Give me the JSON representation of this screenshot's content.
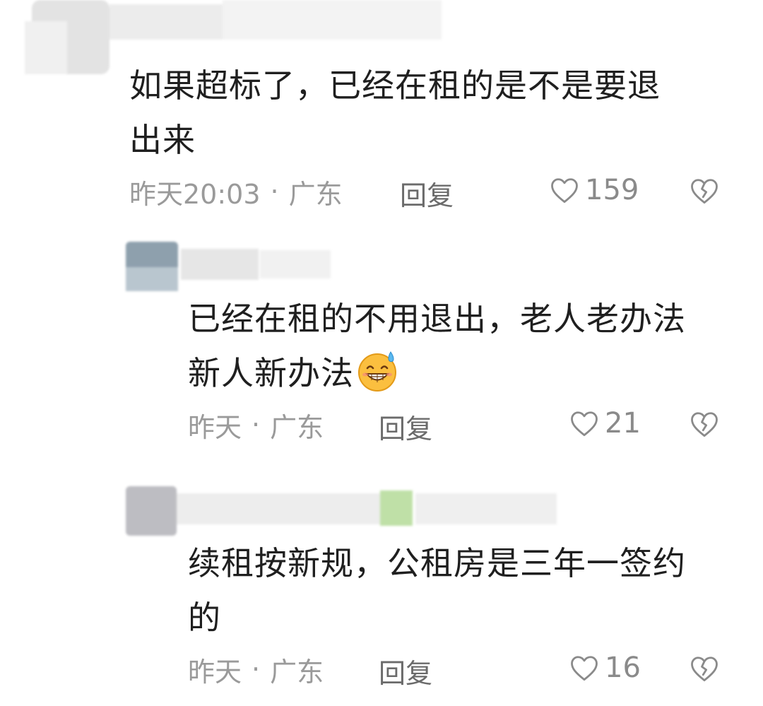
{
  "comments": [
    {
      "text_line1": "如果超标了，已经在租的是不是要退",
      "text_line2": "出来",
      "time": "昨天20:03",
      "separator": "·",
      "location": "广东",
      "reply_label": "回复",
      "likes": "159",
      "icons": {
        "like": "heart-outline-icon",
        "dislike": "broken-heart-icon"
      }
    },
    {
      "text_line1": "已经在租的不用退出，老人老办法",
      "text_line2": "新人新办法",
      "emoji": "grinning-sweat-emoji",
      "time": "昨天",
      "separator": "·",
      "location": "广东",
      "reply_label": "回复",
      "likes": "21",
      "icons": {
        "like": "heart-outline-icon",
        "dislike": "broken-heart-icon"
      }
    },
    {
      "text_line1": "续租按新规，公租房是三年一签约",
      "text_line2": "的",
      "time": "昨天",
      "separator": "·",
      "location": "广东",
      "reply_label": "回复",
      "likes": "16",
      "icons": {
        "like": "heart-outline-icon",
        "dislike": "broken-heart-icon"
      }
    }
  ],
  "colors": {
    "meta_text": "#9a9a9a",
    "reply_text": "#6b6b6b",
    "body_text": "#1f1f1f",
    "icon_stroke": "#8a8a8a"
  }
}
